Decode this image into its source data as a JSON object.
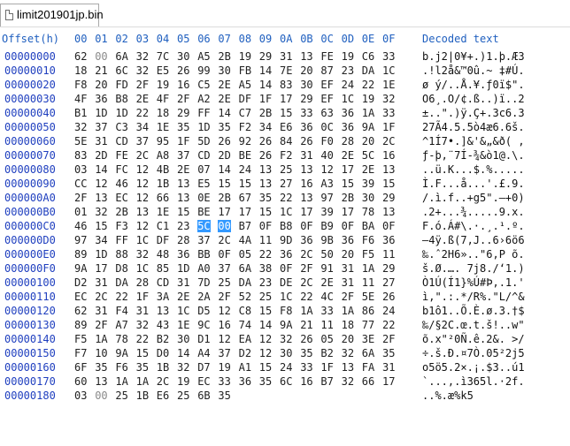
{
  "tab": {
    "label": "limit201901jp.bin"
  },
  "header": {
    "offset_label": "Offset(h)",
    "columns": [
      "00",
      "01",
      "02",
      "03",
      "04",
      "05",
      "06",
      "07",
      "08",
      "09",
      "0A",
      "0B",
      "0C",
      "0D",
      "0E",
      "0F"
    ],
    "decoded_label": "Decoded text"
  },
  "rows": [
    {
      "offset": "00000000",
      "bytes": [
        "62",
        "00",
        "6A",
        "32",
        "7C",
        "30",
        "A5",
        "2B",
        "19",
        "29",
        "31",
        "13",
        "FE",
        "19",
        "C6",
        "33"
      ],
      "decoded": "b.j2|0¥+.)1.þ.Æ3"
    },
    {
      "offset": "00000010",
      "bytes": [
        "18",
        "21",
        "6C",
        "32",
        "E5",
        "26",
        "99",
        "30",
        "FB",
        "14",
        "7E",
        "20",
        "87",
        "23",
        "DA",
        "1C"
      ],
      "decoded": ".!l2å&™0û.~ ‡#Ú."
    },
    {
      "offset": "00000020",
      "bytes": [
        "F8",
        "20",
        "FD",
        "2F",
        "19",
        "16",
        "C5",
        "2E",
        "A5",
        "14",
        "83",
        "30",
        "EF",
        "24",
        "22",
        "1E"
      ],
      "decoded": "ø ý/..Å.¥.ƒ0ï$\"."
    },
    {
      "offset": "00000030",
      "bytes": [
        "4F",
        "36",
        "B8",
        "2E",
        "4F",
        "2F",
        "A2",
        "2E",
        "DF",
        "1F",
        "17",
        "29",
        "EF",
        "1C",
        "19",
        "32"
      ],
      "decoded": "O6¸.O/¢.ß..)ï..2"
    },
    {
      "offset": "00000040",
      "bytes": [
        "B1",
        "1D",
        "1D",
        "22",
        "18",
        "29",
        "FF",
        "14",
        "C7",
        "2B",
        "15",
        "33",
        "63",
        "36",
        "1A",
        "33"
      ],
      "decoded": "±..\".)ÿ.Ç+.3c6.3"
    },
    {
      "offset": "00000050",
      "bytes": [
        "32",
        "37",
        "C3",
        "34",
        "1E",
        "35",
        "1D",
        "35",
        "F2",
        "34",
        "E6",
        "36",
        "0C",
        "36",
        "9A",
        "1F"
      ],
      "decoded": "27Ã4.5.5ò4æ6.6š."
    },
    {
      "offset": "00000060",
      "bytes": [
        "5E",
        "31",
        "CD",
        "37",
        "95",
        "1F",
        "5D",
        "26",
        "92",
        "26",
        "84",
        "26",
        "F0",
        "28",
        "20",
        "2C"
      ],
      "decoded": "^1Í7•.]&'&„&ð( ,"
    },
    {
      "offset": "00000070",
      "bytes": [
        "83",
        "2D",
        "FE",
        "2C",
        "A8",
        "37",
        "CD",
        "2D",
        "BE",
        "26",
        "F2",
        "31",
        "40",
        "2E",
        "5C",
        "16"
      ],
      "decoded": "ƒ-þ,¨7Í-¾&ò1@.\\."
    },
    {
      "offset": "00000080",
      "bytes": [
        "03",
        "14",
        "FC",
        "12",
        "4B",
        "2E",
        "07",
        "14",
        "24",
        "13",
        "25",
        "13",
        "12",
        "17",
        "2E",
        "13"
      ],
      "decoded": "..ü.K...$.%....."
    },
    {
      "offset": "00000090",
      "bytes": [
        "CC",
        "12",
        "46",
        "12",
        "1B",
        "13",
        "E5",
        "15",
        "15",
        "13",
        "27",
        "16",
        "A3",
        "15",
        "39",
        "15"
      ],
      "decoded": "Ì.F...å...'.£.9."
    },
    {
      "offset": "000000A0",
      "bytes": [
        "2F",
        "13",
        "EC",
        "12",
        "66",
        "13",
        "0E",
        "2B",
        "67",
        "35",
        "22",
        "13",
        "97",
        "2B",
        "30",
        "29"
      ],
      "decoded": "/.ì.f..+g5\".—+0)"
    },
    {
      "offset": "000000B0",
      "bytes": [
        "01",
        "32",
        "2B",
        "13",
        "1E",
        "15",
        "BE",
        "17",
        "17",
        "15",
        "1C",
        "17",
        "39",
        "17",
        "78",
        "13"
      ],
      "decoded": ".2+...¾.....9.x."
    },
    {
      "offset": "000000C0",
      "bytes": [
        "46",
        "15",
        "F3",
        "12",
        "C1",
        "23",
        "5C",
        "00",
        "B7",
        "0F",
        "B8",
        "0F",
        "B9",
        "0F",
        "BA",
        "0F"
      ],
      "decoded": "F.ó.Á#\\.·.¸.¹.º."
    },
    {
      "offset": "000000D0",
      "bytes": [
        "97",
        "34",
        "FF",
        "1C",
        "DF",
        "28",
        "37",
        "2C",
        "4A",
        "11",
        "9D",
        "36",
        "9B",
        "36",
        "F6",
        "36"
      ],
      "decoded": "—4ÿ.ß(7,J..6›6ö6"
    },
    {
      "offset": "000000E0",
      "bytes": [
        "89",
        "1D",
        "88",
        "32",
        "48",
        "36",
        "BB",
        "0F",
        "05",
        "22",
        "36",
        "2C",
        "50",
        "20",
        "F5",
        "11"
      ],
      "decoded": "‰.ˆ2H6»..\"6,P õ."
    },
    {
      "offset": "000000F0",
      "bytes": [
        "9A",
        "17",
        "D8",
        "1C",
        "85",
        "1D",
        "A0",
        "37",
        "6A",
        "38",
        "0F",
        "2F",
        "91",
        "31",
        "1A",
        "29"
      ],
      "decoded": "š.Ø.…. 7j8./‘1.)"
    },
    {
      "offset": "00000100",
      "bytes": [
        "D2",
        "31",
        "DA",
        "28",
        "CD",
        "31",
        "7D",
        "25",
        "DA",
        "23",
        "DE",
        "2C",
        "2E",
        "31",
        "11",
        "27"
      ],
      "decoded": "Ò1Ú(Í1}%Ú#Þ,.1.'"
    },
    {
      "offset": "00000110",
      "bytes": [
        "EC",
        "2C",
        "22",
        "1F",
        "3A",
        "2E",
        "2A",
        "2F",
        "52",
        "25",
        "1C",
        "22",
        "4C",
        "2F",
        "5E",
        "26"
      ],
      "decoded": "ì,\".:.*/R%.\"L/^&"
    },
    {
      "offset": "00000120",
      "bytes": [
        "62",
        "31",
        "F4",
        "31",
        "13",
        "1C",
        "D5",
        "12",
        "C8",
        "15",
        "F8",
        "1A",
        "33",
        "1A",
        "86",
        "24"
      ],
      "decoded": "b1ô1..Õ.È.ø.3.†$"
    },
    {
      "offset": "00000130",
      "bytes": [
        "89",
        "2F",
        "A7",
        "32",
        "43",
        "1E",
        "9C",
        "16",
        "74",
        "14",
        "9A",
        "21",
        "11",
        "18",
        "77",
        "22"
      ],
      "decoded": "‰/§2C.œ.t.š!..w\""
    },
    {
      "offset": "00000140",
      "bytes": [
        "F5",
        "1A",
        "78",
        "22",
        "B2",
        "30",
        "D1",
        "12",
        "EA",
        "12",
        "32",
        "26",
        "05",
        "20",
        "3E",
        "2F"
      ],
      "decoded": "õ.x\"²0Ñ.ê.2&. >/"
    },
    {
      "offset": "00000150",
      "bytes": [
        "F7",
        "10",
        "9A",
        "15",
        "D0",
        "14",
        "A4",
        "37",
        "D2",
        "12",
        "30",
        "35",
        "B2",
        "32",
        "6A",
        "35"
      ],
      "decoded": "÷.š.Ð.¤7Ò.05²2j5"
    },
    {
      "offset": "00000160",
      "bytes": [
        "6F",
        "35",
        "F6",
        "35",
        "1B",
        "32",
        "D7",
        "19",
        "A1",
        "15",
        "24",
        "33",
        "1F",
        "13",
        "FA",
        "31"
      ],
      "decoded": "o5ö5.2×.¡.$3..ú1"
    },
    {
      "offset": "00000170",
      "bytes": [
        "60",
        "13",
        "1A",
        "1A",
        "2C",
        "19",
        "EC",
        "33",
        "36",
        "35",
        "6C",
        "16",
        "B7",
        "32",
        "66",
        "17"
      ],
      "decoded": "`...,.ì365l.·2f."
    },
    {
      "offset": "00000180",
      "bytes": [
        "03",
        "00",
        "25",
        "1B",
        "E6",
        "25",
        "6B",
        "35"
      ],
      "decoded": "..%.æ%k5"
    }
  ],
  "selection": {
    "row": 12,
    "start": 6,
    "end": 7
  },
  "colors": {
    "selection": "#3399ff",
    "offset": "#1f3fbf",
    "header": "#1f5fbf"
  }
}
